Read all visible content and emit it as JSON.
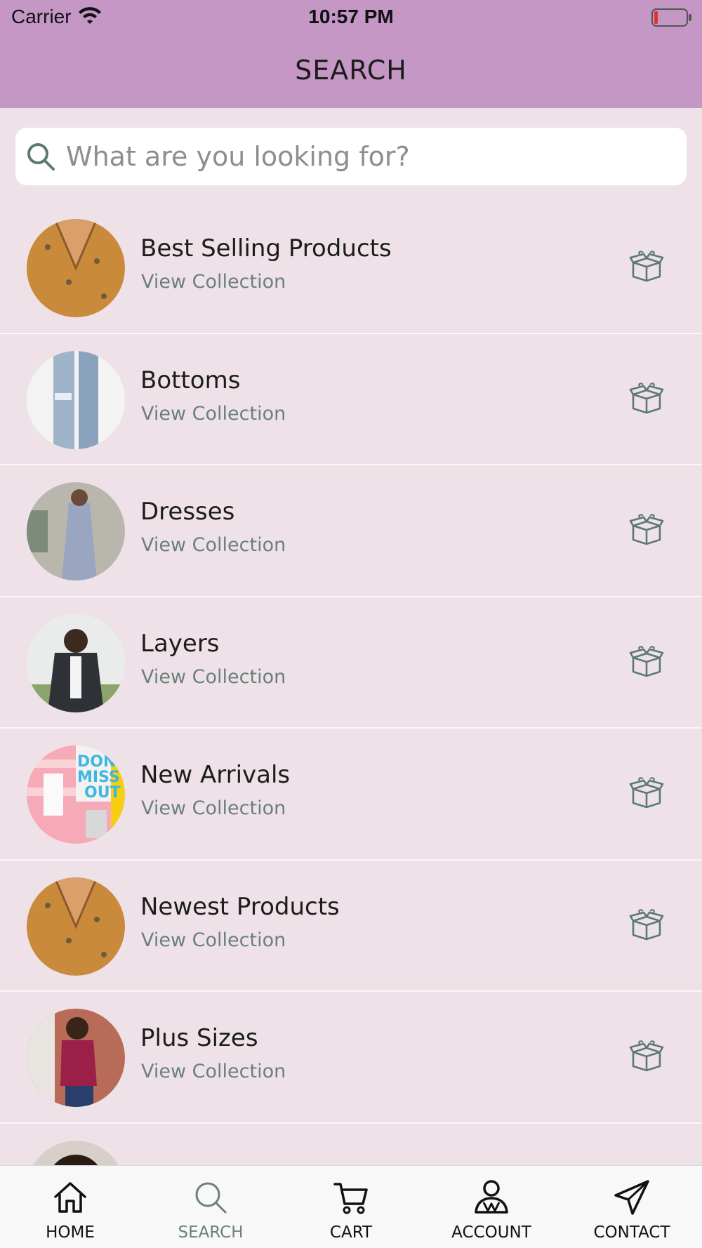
{
  "status_bar": {
    "carrier": "Carrier",
    "time": "10:57 PM"
  },
  "header": {
    "title": "SEARCH",
    "background": "#c497c4"
  },
  "search": {
    "placeholder": "What are you looking for?"
  },
  "collections": [
    {
      "title": "Best Selling Products",
      "subtitle": "View Collection",
      "icon": "gift-box-icon"
    },
    {
      "title": "Bottoms",
      "subtitle": "View Collection",
      "icon": "gift-box-icon"
    },
    {
      "title": "Dresses",
      "subtitle": "View Collection",
      "icon": "gift-box-icon"
    },
    {
      "title": "Layers",
      "subtitle": "View Collection",
      "icon": "gift-box-icon"
    },
    {
      "title": "New Arrivals",
      "subtitle": "View Collection",
      "icon": "gift-box-icon"
    },
    {
      "title": "Newest Products",
      "subtitle": "View Collection",
      "icon": "gift-box-icon"
    },
    {
      "title": "Plus Sizes",
      "subtitle": "View Collection",
      "icon": "gift-box-icon"
    },
    {
      "title": "",
      "subtitle": "",
      "icon": "gift-box-icon"
    }
  ],
  "tabs": [
    {
      "label": "HOME",
      "icon": "home-icon",
      "active": false
    },
    {
      "label": "SEARCH",
      "icon": "search-icon",
      "active": true
    },
    {
      "label": "CART",
      "icon": "cart-icon",
      "active": false
    },
    {
      "label": "ACCOUNT",
      "icon": "account-icon",
      "active": false
    },
    {
      "label": "CONTACT",
      "icon": "paper-plane-icon",
      "active": false
    }
  ],
  "colors": {
    "accent": "#6b807a",
    "list_background": "#eee2e8"
  }
}
